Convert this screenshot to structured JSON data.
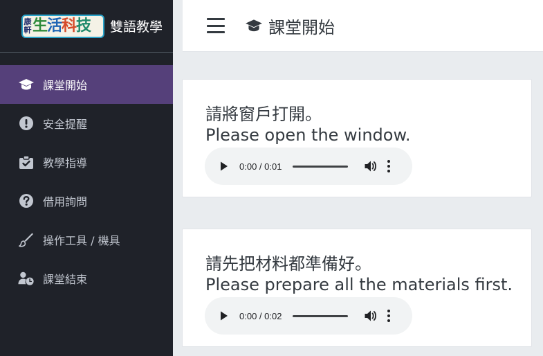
{
  "brand": {
    "logo_side_text": "康軒",
    "logo_chars": [
      "生",
      "活",
      "科",
      "技"
    ],
    "title": "雙語教學"
  },
  "sidebar": {
    "items": [
      {
        "label": "課堂開始",
        "icon": "graduation-cap-icon",
        "active": true
      },
      {
        "label": "安全提醒",
        "icon": "exclamation-circle-icon",
        "active": false
      },
      {
        "label": "教學指導",
        "icon": "clipboard-check-icon",
        "active": false
      },
      {
        "label": "借用詢問",
        "icon": "question-circle-icon",
        "active": false
      },
      {
        "label": "操作工具 / 機具",
        "icon": "tool-brush-icon",
        "active": false
      },
      {
        "label": "課堂結束",
        "icon": "user-clock-icon",
        "active": false
      }
    ]
  },
  "header": {
    "title": "課堂開始",
    "title_icon": "graduation-cap-icon",
    "menu_icon": "hamburger-menu-icon"
  },
  "cards": [
    {
      "zh": "請將窗戶打開。",
      "en": "Please open the window.",
      "audio": {
        "time": "0:00 / 0:01"
      }
    },
    {
      "zh": "請先把材料都準備好。",
      "en": "Please prepare all the materials first.",
      "audio": {
        "time": "0:00 / 0:02"
      }
    }
  ],
  "colors": {
    "sidebar_bg": "#1f2229",
    "active_item_bg": "#55407a",
    "content_bg": "#e9ecef",
    "audio_bg": "#f1f3f4"
  }
}
